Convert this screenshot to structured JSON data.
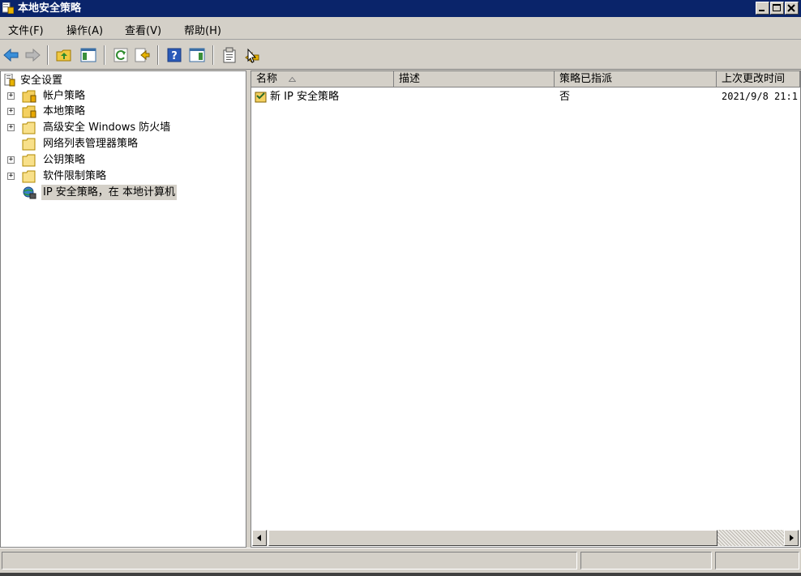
{
  "window": {
    "title": "本地安全策略"
  },
  "menu": {
    "items": [
      {
        "label": "文件(F)"
      },
      {
        "label": "操作(A)"
      },
      {
        "label": "查看(V)"
      },
      {
        "label": "帮助(H)"
      }
    ]
  },
  "tree": {
    "root": "安全设置",
    "items": [
      {
        "label": "帐户策略",
        "icon": "folder-key-icon",
        "expandable": true
      },
      {
        "label": "本地策略",
        "icon": "folder-key-icon",
        "expandable": true
      },
      {
        "label": "高级安全 Windows 防火墙",
        "icon": "folder-icon",
        "expandable": true
      },
      {
        "label": "网络列表管理器策略",
        "icon": "folder-icon",
        "expandable": false
      },
      {
        "label": "公钥策略",
        "icon": "folder-icon",
        "expandable": true
      },
      {
        "label": "软件限制策略",
        "icon": "folder-icon",
        "expandable": true
      },
      {
        "label": "IP 安全策略，在 本地计算机",
        "icon": "ip-security-icon",
        "expandable": false,
        "selected": true
      }
    ]
  },
  "list": {
    "columns": [
      {
        "label": "名称"
      },
      {
        "label": "描述"
      },
      {
        "label": "策略已指派"
      },
      {
        "label": "上次更改时间"
      }
    ],
    "rows": [
      {
        "name": "新 IP 安全策略",
        "description": "",
        "assigned": "否",
        "modified": "2021/9/8 21:1"
      }
    ]
  },
  "colors": {
    "titlebar": "#0a246a",
    "chrome": "#d4d0c8",
    "selection": "#d4d0c8"
  }
}
